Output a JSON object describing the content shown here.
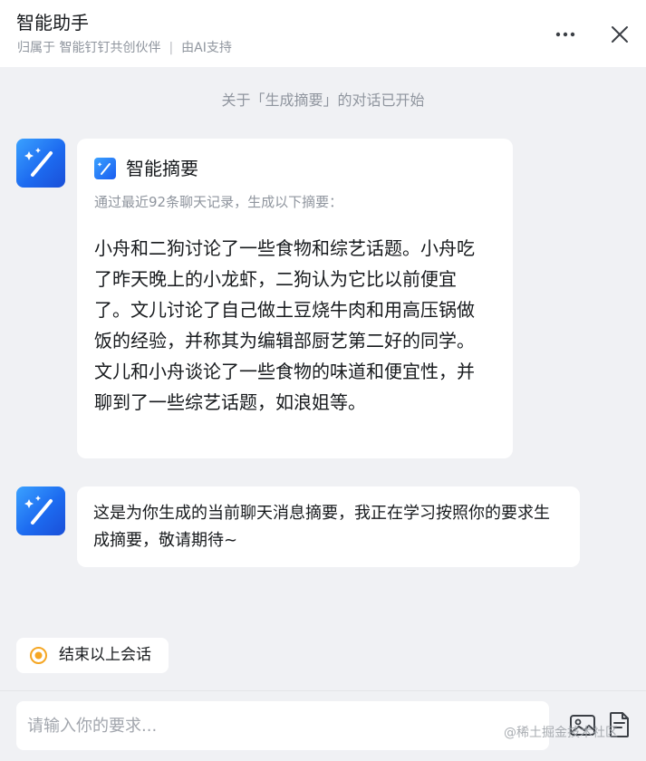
{
  "header": {
    "title": "智能助手",
    "subtitle_owner": "归属于 智能钉钉共创伙伴",
    "subtitle_separator": "|",
    "subtitle_support": "由AI支持"
  },
  "system_notice": "关于「生成摘要」的对话已开始",
  "summary_card": {
    "title": "智能摘要",
    "description": "通过最近92条聊天记录，生成以下摘要：",
    "body": "小舟和二狗讨论了一些食物和综艺话题。小舟吃了昨天晚上的小龙虾，二狗认为它比以前便宜了。文儿讨论了自己做土豆烧牛肉和用高压锅做饭的经验，并称其为编辑部厨艺第二好的同学。文儿和小舟谈论了一些食物的味道和便宜性，并聊到了一些综艺话题，如浪姐等。"
  },
  "reply": {
    "text": "这是为你生成的当前聊天消息摘要，我正在学习按照你的要求生成摘要，敬请期待~"
  },
  "end_session": {
    "label": "结束以上会话"
  },
  "input": {
    "value": "",
    "placeholder": "请输入你的要求..."
  },
  "watermark": "@稀土掘金技术社区",
  "icons": {
    "header_more": "more-horizontal-icon",
    "header_close": "close-icon",
    "avatar": "magic-wand-icon",
    "card": "magic-wand-icon",
    "end_session": "stop-circle-icon",
    "image_upload": "image-icon",
    "document": "document-icon"
  },
  "colors": {
    "accent_blue": "#1d6bf0",
    "end_session_orange": "#f5a623",
    "background": "#f0f1f4",
    "muted_text": "#8f959e"
  }
}
